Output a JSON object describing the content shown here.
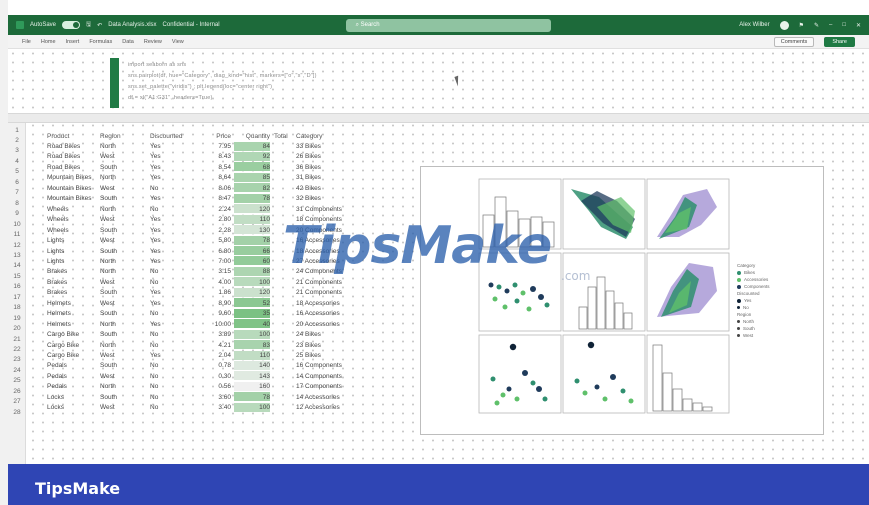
{
  "titlebar": {
    "autosave_label": "AutoSave",
    "filename": "Data Analysis.xlsx",
    "sensitivity": "Confidential - Internal",
    "search_placeholder": "Search",
    "user_name": "Alex Wilber"
  },
  "ribbon": {
    "tabs": [
      "File",
      "Home",
      "Insert",
      "Formulas",
      "Data",
      "Review",
      "View"
    ],
    "comments_label": "Comments",
    "share_label": "Share"
  },
  "code": {
    "lines": [
      "import seaborn as sns",
      "sns.pairplot(df, hue=\"Category\", diag_kind=\"hist\", markers=[\"o\",\"s\",\"D\"])",
      "sns.set_palette(\"viridis\") ; plt.legend(loc=\"center right\")",
      "df = xl(\"A1:G31\", headers=True)"
    ]
  },
  "table": {
    "headers": [
      "Product",
      "Region",
      "Discounted",
      "Price",
      "Quantity",
      "Total",
      "Category"
    ],
    "rows": [
      [
        "Road Bikes",
        "North",
        "Yes",
        "7.95",
        "84",
        "",
        "33 Bikes"
      ],
      [
        "Road Bikes",
        "West",
        "Yes",
        "8.43",
        "92",
        "",
        "26 Bikes"
      ],
      [
        "Road Bikes",
        "South",
        "Yes",
        "8.54",
        "68",
        "",
        "36 Bikes"
      ],
      [
        "Mountain Bikes",
        "North",
        "Yes",
        "8.64",
        "85",
        "",
        "31 Bikes"
      ],
      [
        "Mountain Bikes",
        "West",
        "No",
        "8.06",
        "82",
        "",
        "42 Bikes"
      ],
      [
        "Mountain Bikes",
        "South",
        "Yes",
        "8.47",
        "78",
        "",
        "32 Bikes"
      ],
      [
        "Wheels",
        "North",
        "No",
        "2.24",
        "120",
        "",
        "31 Components"
      ],
      [
        "Wheels",
        "West",
        "Yes",
        "2.80",
        "110",
        "",
        "18 Components"
      ],
      [
        "Wheels",
        "South",
        "Yes",
        "2.28",
        "130",
        "",
        "20 Components"
      ],
      [
        "Lights",
        "West",
        "Yes",
        "5.80",
        "78",
        "",
        "16 Accessories"
      ],
      [
        "Lights",
        "South",
        "Yes",
        "6.80",
        "66",
        "",
        "18 Accessories"
      ],
      [
        "Lights",
        "North",
        "Yes",
        "7.00",
        "60",
        "",
        "27 Accessories"
      ],
      [
        "Brakes",
        "North",
        "No",
        "3.15",
        "88",
        "",
        "24 Components"
      ],
      [
        "Brakes",
        "West",
        "No",
        "4.00",
        "100",
        "",
        "21 Components"
      ],
      [
        "Brakes",
        "South",
        "Yes",
        "1.86",
        "120",
        "",
        "21 Components"
      ],
      [
        "Helmets",
        "West",
        "Yes",
        "8.90",
        "52",
        "",
        "18 Accessories"
      ],
      [
        "Helmets",
        "South",
        "No",
        "9.60",
        "35",
        "",
        "16 Accessories"
      ],
      [
        "Helmets",
        "North",
        "Yes",
        "10.00",
        "40",
        "",
        "20 Accessories"
      ],
      [
        "Cargo Bike",
        "South",
        "No",
        "3.89",
        "100",
        "",
        "24 Bikes"
      ],
      [
        "Cargo Bike",
        "North",
        "No",
        "4.21",
        "83",
        "",
        "23 Bikes"
      ],
      [
        "Cargo Bike",
        "West",
        "Yes",
        "2.04",
        "110",
        "",
        "25 Bikes"
      ],
      [
        "Pedals",
        "South",
        "No",
        "0.78",
        "140",
        "",
        "16 Components"
      ],
      [
        "Pedals",
        "West",
        "No",
        "0.30",
        "143",
        "",
        "14 Components"
      ],
      [
        "Pedals",
        "North",
        "No",
        "0.56",
        "160",
        "",
        "17 Components"
      ],
      [
        "Locks",
        "South",
        "No",
        "3.60",
        "78",
        "",
        "14 Accessories"
      ],
      [
        "Locks",
        "West",
        "No",
        "3.40",
        "100",
        "",
        "12 Accessories"
      ]
    ]
  },
  "chart": {
    "legend_title_1": "Category",
    "categories": [
      "Bikes",
      "Accessories",
      "Components"
    ],
    "legend_title_2": "Discounted",
    "discounted": [
      "Yes",
      "No"
    ],
    "legend_title_3": "Region",
    "regions": [
      "North",
      "South",
      "West"
    ],
    "colors": {
      "bikes": "#2f8f6f",
      "accessories": "#5fc06a",
      "components": "#1f3b5b",
      "lilac": "#a99ad6",
      "hist": "#ffffff"
    }
  },
  "watermark": {
    "main": "TipsMake",
    "suffix": ".com"
  },
  "brand": {
    "name": "TipsMake"
  }
}
